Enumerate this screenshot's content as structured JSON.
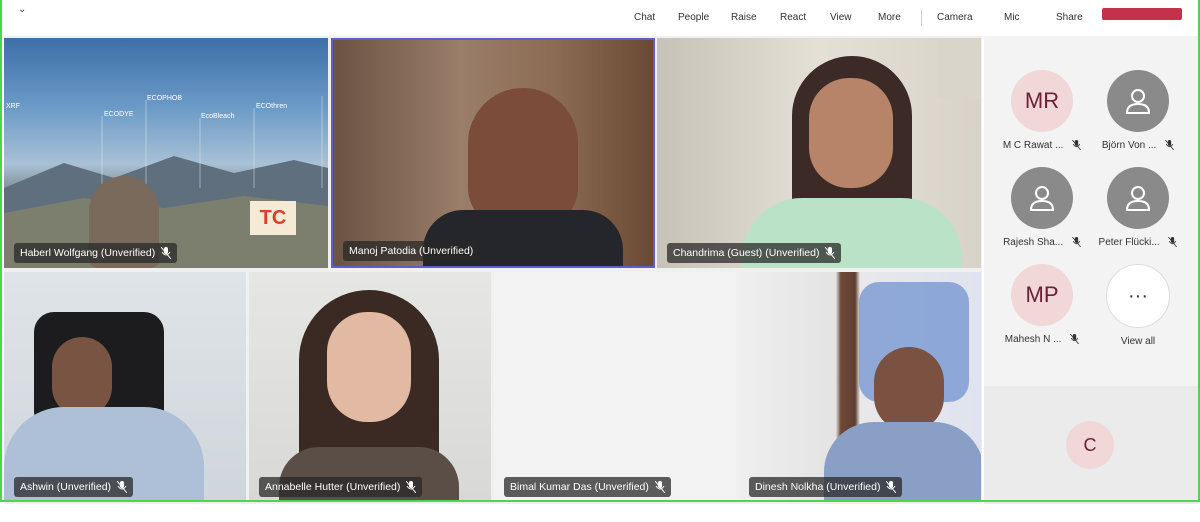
{
  "toolbar": {
    "chat": "Chat",
    "people": "People",
    "raise": "Raise",
    "react": "React",
    "view": "View",
    "more": "More",
    "camera": "Camera",
    "mic": "Mic",
    "share": "Share"
  },
  "banner_text": "TC",
  "chart_labels": [
    "XRF",
    "ECODYE",
    "ECOPHOB",
    "EcoBleach",
    "ECOthren"
  ],
  "tiles": [
    {
      "name": "Haberl Wolfgang (Unverified)"
    },
    {
      "name": "Manoj Patodia (Unverified)"
    },
    {
      "name": "Chandrima (Guest) (Unverified)"
    },
    {
      "name": "Ashwin (Unverified)"
    },
    {
      "name": "Annabelle Hutter (Unverified)"
    },
    {
      "name": "Bimal Kumar Das (Unverified)"
    },
    {
      "name": "Dinesh Nolkha (Unverified)"
    }
  ],
  "sidebar": {
    "people": [
      {
        "initials": "MR",
        "name": "M C Rawat ..."
      },
      {
        "initials": "",
        "name": "Björn Von ..."
      },
      {
        "initials": "",
        "name": "Rajesh Sha..."
      },
      {
        "initials": "",
        "name": "Peter Flücki..."
      },
      {
        "initials": "MP",
        "name": "Mahesh N ..."
      }
    ],
    "view_all": "View all",
    "more_glyph": "···",
    "self_initial": "C"
  },
  "colors": {
    "accent_green": "#4cd64c",
    "leave_red": "#c4314b",
    "active_border": "#5b5fc7",
    "avatar_bg": "#f1d7d7"
  }
}
